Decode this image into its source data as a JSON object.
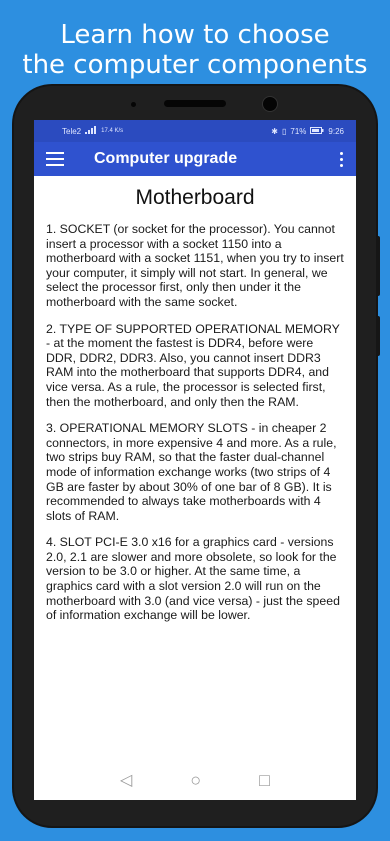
{
  "promo": {
    "line1": "Learn how to choose",
    "line2": "the computer components"
  },
  "status_bar": {
    "carrier": "Tele2",
    "net_speed": "17.4 K/s",
    "battery": "71%",
    "time": "9:26"
  },
  "app_bar": {
    "title": "Computer upgrade"
  },
  "content": {
    "heading": "Motherboard",
    "paragraphs": [
      "1. SOCKET (or socket for the processor). You cannot insert a processor with a socket 1150 into a motherboard with a socket 1151, when you try to insert your computer, it simply will not start. In general, we select the processor first, only then under it the motherboard with the same socket.",
      "2. TYPE OF SUPPORTED OPERATIONAL MEMORY - at the moment the fastest is DDR4, before were DDR, DDR2, DDR3. Also, you cannot insert DDR3 RAM into the motherboard that supports DDR4, and vice versa. As a rule, the processor is selected first, then the motherboard, and only then the RAM.",
      "3. OPERATIONAL MEMORY SLOTS - in cheaper 2 connectors, in more expensive 4 and more. As a rule, two strips buy RAM, so that the faster dual-channel mode of information exchange works (two strips of 4 GB are faster by about 30% of one bar of 8 GB). It is recommended to always take motherboards with 4 slots of RAM.",
      "4. SLOT PCI-E 3.0 x16 for a graphics card - versions 2.0, 2.1 are slower and more obsolete, so look for the version to be 3.0 or higher. At the same time, a graphics card with a slot version 2.0 will run on the motherboard with 3.0 (and vice versa) - just the speed of information exchange will be lower."
    ]
  },
  "nav": {
    "back": "◁",
    "home": "○",
    "recents": "□"
  },
  "colors": {
    "background": "#2d8fe0",
    "app_bar": "#2f52cf",
    "status_bar": "#2b4bbf"
  }
}
